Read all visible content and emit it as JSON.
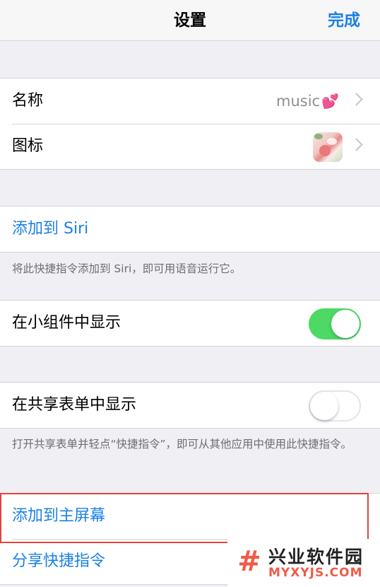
{
  "navbar": {
    "title": "设置",
    "done_label": "完成"
  },
  "details": {
    "name_label": "名称",
    "name_value": "music",
    "name_emoji": "💕",
    "icon_label": "图标",
    "icon_name": "app-thumbnail-icon"
  },
  "siri": {
    "add_label": "添加到 Siri",
    "note": "将此快捷指令添加到 Siri，即可用语音运行它。"
  },
  "widget": {
    "label": "在小组件中显示",
    "enabled": true
  },
  "share_sheet": {
    "label": "在共享表单中显示",
    "enabled": false,
    "note": "打开共享表单并轻点“快捷指令”，即可从其他应用中使用此快捷指令。"
  },
  "actions": {
    "home_screen_label": "添加到主屏幕",
    "share_label": "分享快捷指令"
  },
  "watermark": {
    "logo": "#",
    "title": "兴业软件园",
    "subtitle": "MYXYJS.COM"
  },
  "colors": {
    "accent": "#1a80e5",
    "toggle_on": "#4cd964",
    "highlight": "#e0453f"
  }
}
